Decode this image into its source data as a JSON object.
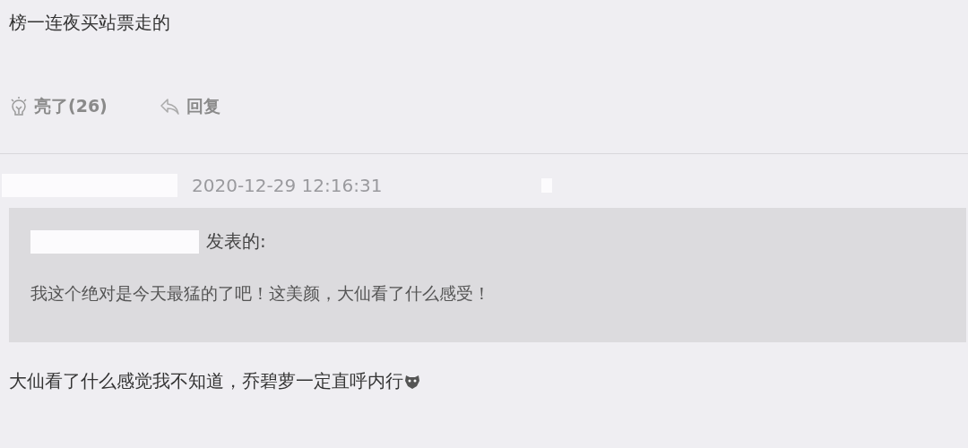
{
  "comment_text": "榜一连夜买站票走的",
  "actions": [
    {
      "kind": "like",
      "label": "亮了(26)"
    },
    {
      "kind": "reply",
      "label": "回复"
    }
  ],
  "reply": {
    "timestamp": "2020-12-29 12:16:31",
    "quote": {
      "posted_label": "发表的:",
      "text": "我这个绝对是今天最猛的了吧！这美颜，大仙看了什么感受！"
    },
    "text": "大仙看了什么感觉我不知道，乔碧萝一定直呼内行"
  }
}
